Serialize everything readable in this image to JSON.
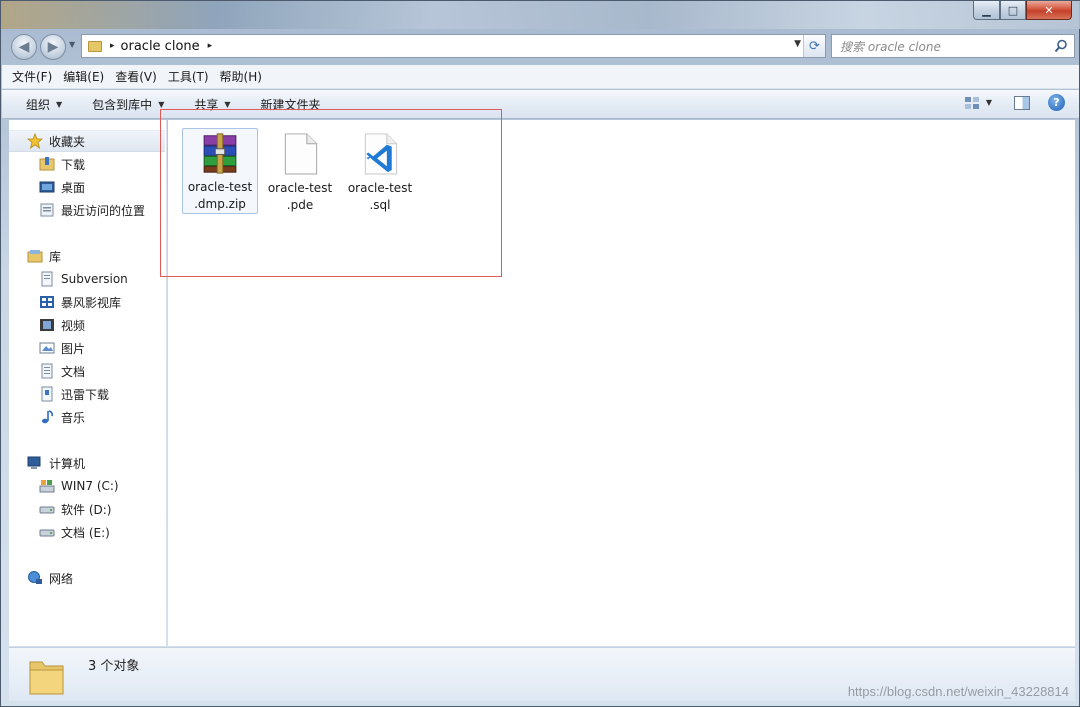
{
  "titlebar": {
    "min_glyph": "▁",
    "max_glyph": "□",
    "close_glyph": "✕"
  },
  "nav": {
    "back_glyph": "◀",
    "forward_glyph": "▶",
    "dropdown_glyph": "▼"
  },
  "address": {
    "separator": "▸",
    "path": "oracle clone",
    "trailing_separator": "▸",
    "dropdown_glyph": "▼",
    "refresh_glyph": "⟳"
  },
  "search": {
    "placeholder": "搜索 oracle clone"
  },
  "menubar": {
    "items": [
      "文件(F)",
      "编辑(E)",
      "查看(V)",
      "工具(T)",
      "帮助(H)"
    ]
  },
  "toolbar": {
    "organize": "组织",
    "include_library": "包含到库中",
    "share": "共享",
    "new_folder": "新建文件夹",
    "caret": "▼",
    "help_glyph": "?"
  },
  "navpane": {
    "favorites": {
      "label": "收藏夹",
      "items": [
        "下载",
        "桌面",
        "最近访问的位置"
      ]
    },
    "libraries": {
      "label": "库",
      "items": [
        "Subversion",
        "暴风影视库",
        "视频",
        "图片",
        "文档",
        "迅雷下载",
        "音乐"
      ]
    },
    "computer": {
      "label": "计算机",
      "items": [
        "WIN7 (C:)",
        "软件 (D:)",
        "文档 (E:)"
      ]
    },
    "network": {
      "label": "网络"
    }
  },
  "files": [
    {
      "line1": "oracle-test",
      "line2": ".dmp.zip",
      "icon": "winrar-archive-icon"
    },
    {
      "line1": "oracle-test",
      "line2": ".pde",
      "icon": "blank-file-icon"
    },
    {
      "line1": "oracle-test",
      "line2": ".sql",
      "icon": "vscode-file-icon"
    }
  ],
  "status": {
    "text": "3 个对象"
  },
  "watermark": "https://blog.csdn.net/weixin_43228814",
  "colors": {
    "accent": "#3b6fb0",
    "annotation_box": "#e15a5a",
    "selection": "#a9c3e6"
  }
}
